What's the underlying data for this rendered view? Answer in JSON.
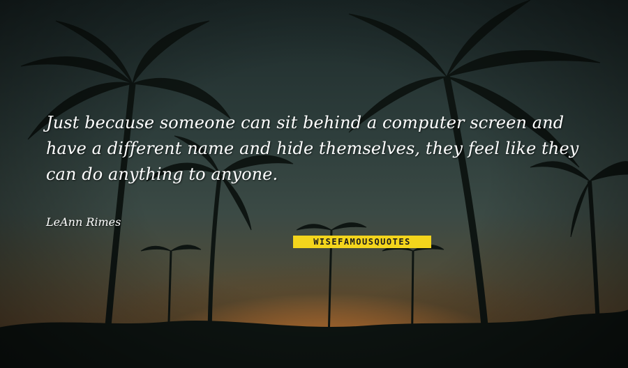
{
  "quote": {
    "text": "Just because someone can sit behind a computer screen and\nhave a different name and hide themselves, they feel like they\ncan do anything to anyone.",
    "author": "LeAnn Rimes"
  },
  "watermark": {
    "text": "WISEFAMOUSQUOTES"
  },
  "colors": {
    "text": "#ffffff",
    "watermark_bg": "#f4d51c",
    "sky_top": "#1d2a2a",
    "horizon_glow": "#d58a3e"
  }
}
